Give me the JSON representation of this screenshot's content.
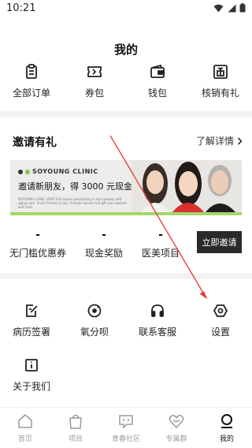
{
  "status": {
    "time": "10:21"
  },
  "page_title": "我的",
  "quick_actions": [
    {
      "label": "全部订单",
      "icon": "clipboard-icon"
    },
    {
      "label": "券包",
      "icon": "ticket-icon"
    },
    {
      "label": "钱包",
      "icon": "wallet-icon"
    },
    {
      "label": "核销有礼",
      "icon": "gift-scan-icon"
    }
  ],
  "invite": {
    "title": "邀请有礼",
    "more_label": "了解详情",
    "banner": {
      "brand": "SOYOUNG CLINIC",
      "headline": "邀请新朋友，得 3000 元现金",
      "fine_print": "SOYOUNG CLINIC LOVE YOU saves specializing in skin beauty anti-aging care. Invite friends to join. Friends receive full gift and rewards and care."
    },
    "stats": [
      {
        "value": "-",
        "label": "无门槛优惠券"
      },
      {
        "value": "-",
        "label": "现金奖励"
      },
      {
        "value": "-",
        "label": "医美项目"
      }
    ],
    "invite_button": "立即邀请"
  },
  "menu": [
    {
      "label": "病历签署",
      "icon": "sign-document-icon"
    },
    {
      "label": "氧分呗",
      "icon": "oxygen-coin-icon"
    },
    {
      "label": "联系客服",
      "icon": "headphones-icon"
    },
    {
      "label": "设置",
      "icon": "settings-hexagon-icon"
    },
    {
      "label": "关于我们",
      "icon": "info-icon"
    }
  ],
  "tabs": [
    {
      "label": "首页",
      "icon": "home-icon",
      "active": false
    },
    {
      "label": "项目",
      "icon": "bag-icon",
      "active": false
    },
    {
      "label": "青春社区",
      "icon": "chat-icon",
      "active": false
    },
    {
      "label": "专属群",
      "icon": "heart-icon",
      "active": false
    },
    {
      "label": "我的",
      "icon": "profile-icon",
      "active": true
    }
  ],
  "colors": {
    "accent": "#2a2a2a",
    "banner_stripe": "#a6d66a",
    "annotation_arrow": "#e53935",
    "tab_inactive": "#9a9a9a"
  }
}
